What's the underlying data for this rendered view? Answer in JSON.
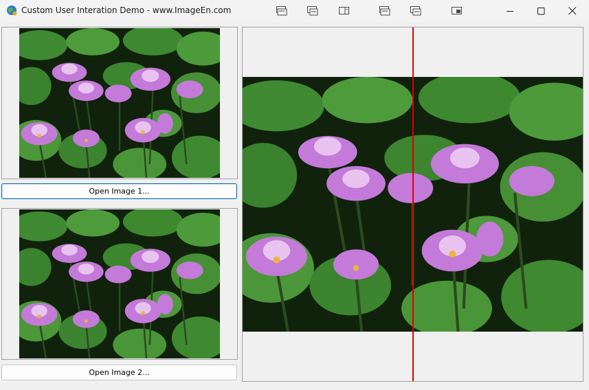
{
  "window": {
    "title": "Custom User Interation Demo - www.ImageEn.com",
    "toolbar_icons": [
      "window-snap-icon",
      "window-snap-alt-icon",
      "panel-layout-icon",
      "window-snap-icon",
      "window-snap-alt-icon",
      "pip-icon"
    ],
    "controls": [
      "minimize-icon",
      "maximize-icon",
      "close-icon"
    ]
  },
  "left": {
    "open_image_1_label": "Open Image 1...",
    "open_image_2_label": "Open Image 2..."
  },
  "colors": {
    "divider": "#e00000",
    "focus_border": "#0067c0",
    "leaf_green": "#4f9a3a",
    "flower_pink": "#c47ad8"
  }
}
